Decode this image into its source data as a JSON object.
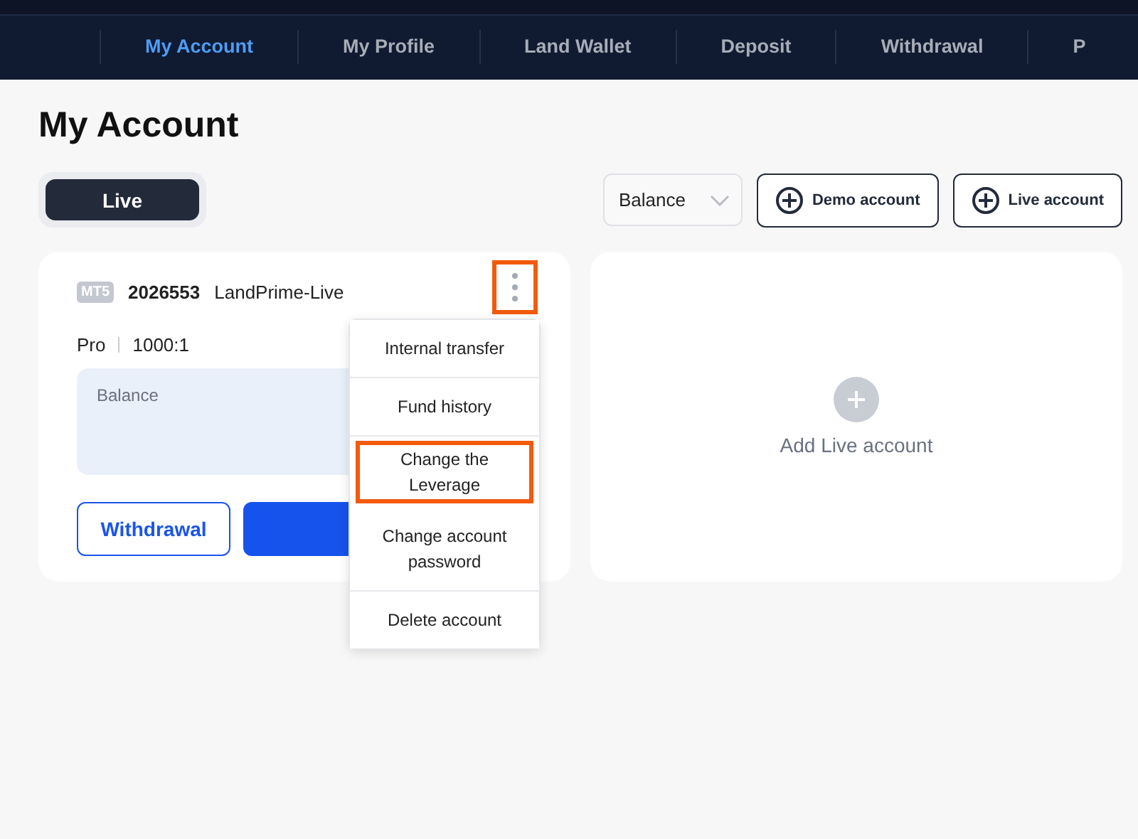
{
  "nav": {
    "items": [
      {
        "label": "My Account",
        "selected": true
      },
      {
        "label": "My Profile",
        "selected": false
      },
      {
        "label": "Land Wallet",
        "selected": false
      },
      {
        "label": "Deposit",
        "selected": false
      },
      {
        "label": "Withdrawal",
        "selected": false
      },
      {
        "label": "P",
        "selected": false
      }
    ]
  },
  "title": "My Account",
  "tabs": [
    {
      "label": "Live",
      "selected": true
    }
  ],
  "sort_select": {
    "value": "Balance"
  },
  "actions": [
    "Demo account",
    "Live account"
  ],
  "account_card": {
    "platform": "MT5",
    "number": "2026553",
    "server": "LandPrime-Live",
    "type": "Pro",
    "leverage": "1000:1",
    "balance_label": "Balance",
    "withdraw_button": "Withdrawal",
    "menu_highlighted": true,
    "menu": [
      {
        "label": "Internal transfer",
        "highlighted": false
      },
      {
        "label": "Fund history",
        "highlighted": false
      },
      {
        "label": "Change the Leverage",
        "highlighted": true
      },
      {
        "label": "Change account password",
        "highlighted": false
      },
      {
        "label": "Delete account",
        "highlighted": false
      }
    ]
  },
  "add_card": {
    "label": "Add Live account"
  }
}
